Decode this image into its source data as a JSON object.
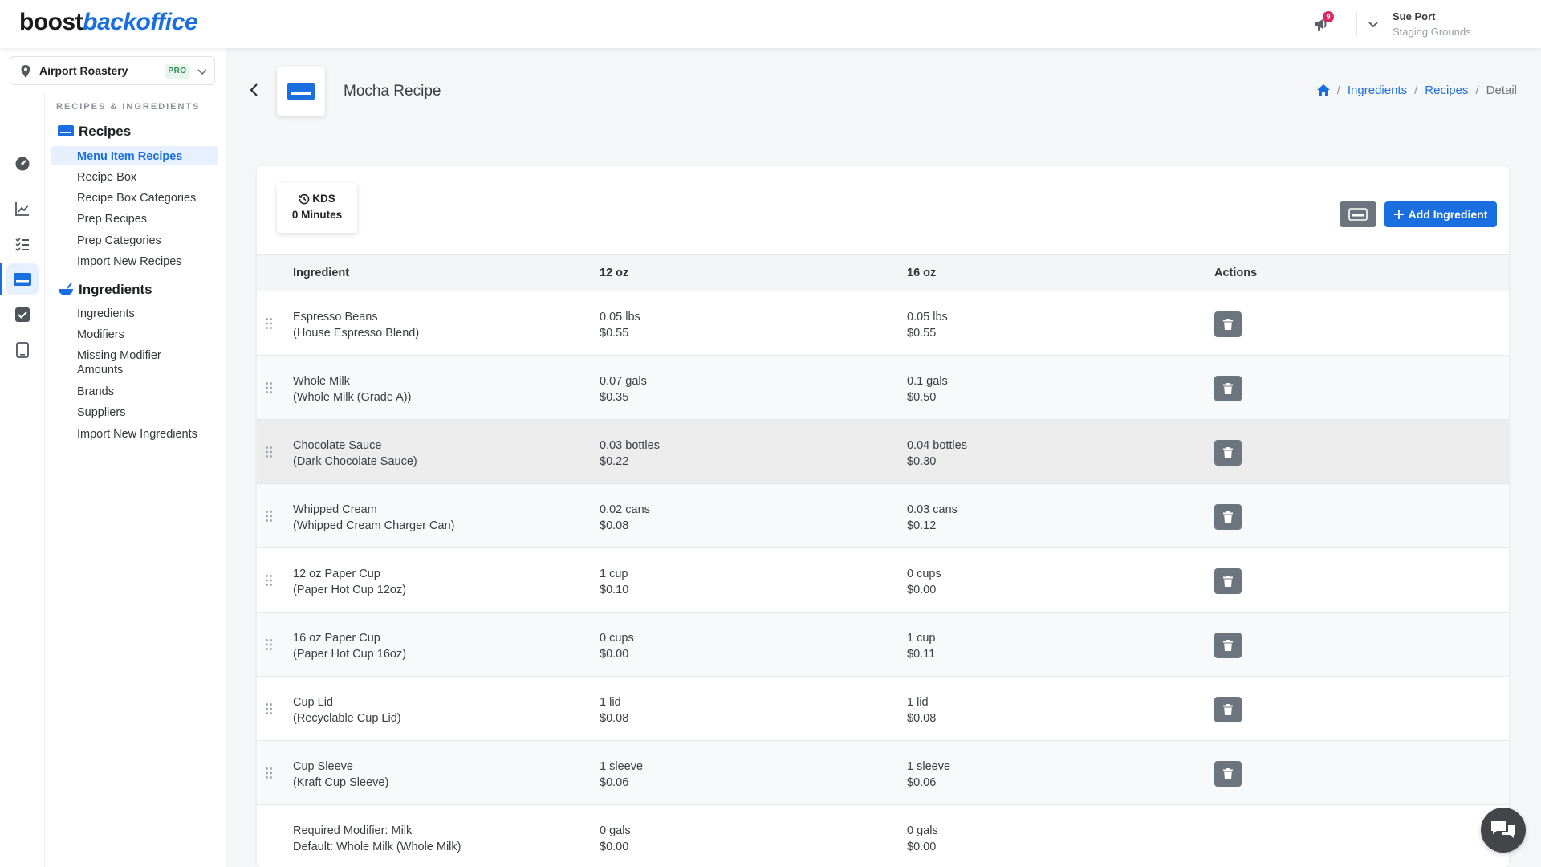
{
  "app": {
    "logo_part1": "boost",
    "logo_part2": "backoffice",
    "brand_color": "#1a6fe0"
  },
  "topbar": {
    "notification_count": "9",
    "user_name": "Sue Port",
    "user_location": "Staging Grounds"
  },
  "store": {
    "name": "Airport Roastery",
    "plan_badge": "PRO"
  },
  "sidebar": {
    "section_title": "RECIPES & INGREDIENTS",
    "recipes_heading": "Recipes",
    "recipes_items": [
      "Menu Item Recipes",
      "Recipe Box",
      "Recipe Box Categories",
      "Prep Recipes",
      "Prep Categories",
      "Import New Recipes"
    ],
    "ingredients_heading": "Ingredients",
    "ingredients_items": [
      "Ingredients",
      "Modifiers",
      "Missing Modifier Amounts",
      "Brands",
      "Suppliers",
      "Import New Ingredients"
    ],
    "rail_icons": [
      "dashboard-icon",
      "chart-icon",
      "checklist-icon",
      "recipe-card-icon",
      "checkbox-icon",
      "tablet-icon"
    ]
  },
  "page": {
    "title": "Mocha Recipe",
    "breadcrumb": [
      "Ingredients",
      "Recipes",
      "Detail"
    ]
  },
  "kds": {
    "label": "KDS",
    "value": "0 Minutes"
  },
  "toolbar": {
    "add_label": "Add Ingredient"
  },
  "table": {
    "headers": [
      "Ingredient",
      "12 oz",
      "16 oz",
      "Actions"
    ],
    "rows": [
      {
        "name": "Espresso Beans",
        "detail": "(House Espresso Blend)",
        "q12": "0.05 lbs",
        "c12": "$0.55",
        "q16": "0.05 lbs",
        "c16": "$0.55"
      },
      {
        "name": "Whole Milk",
        "detail": "(Whole Milk (Grade A))",
        "q12": "0.07 gals",
        "c12": "$0.35",
        "q16": "0.1 gals",
        "c16": "$0.50"
      },
      {
        "name": "Chocolate Sauce",
        "detail": "(Dark Chocolate Sauce)",
        "q12": "0.03 bottles",
        "c12": "$0.22",
        "q16": "0.04 bottles",
        "c16": "$0.30"
      },
      {
        "name": "Whipped Cream",
        "detail": "(Whipped Cream Charger Can)",
        "q12": "0.02 cans",
        "c12": "$0.08",
        "q16": "0.03 cans",
        "c16": "$0.12"
      },
      {
        "name": "12 oz Paper Cup",
        "detail": "(Paper Hot Cup 12oz)",
        "q12": "1 cup",
        "c12": "$0.10",
        "q16": "0 cups",
        "c16": "$0.00"
      },
      {
        "name": "16 oz Paper Cup",
        "detail": "(Paper Hot Cup 16oz)",
        "q12": "0 cups",
        "c12": "$0.00",
        "q16": "1 cup",
        "c16": "$0.11"
      },
      {
        "name": "Cup Lid",
        "detail": "(Recyclable Cup Lid)",
        "q12": "1 lid",
        "c12": "$0.08",
        "q16": "1 lid",
        "c16": "$0.08"
      },
      {
        "name": "Cup Sleeve",
        "detail": "(Kraft Cup Sleeve)",
        "q12": "1 sleeve",
        "c12": "$0.06",
        "q16": "1 sleeve",
        "c16": "$0.06"
      },
      {
        "name": "Required Modifier: Milk",
        "detail": "Default: Whole Milk (Whole Milk)",
        "q12": "0 gals",
        "c12": "$0.00",
        "q16": "0 gals",
        "c16": "$0.00"
      }
    ]
  }
}
